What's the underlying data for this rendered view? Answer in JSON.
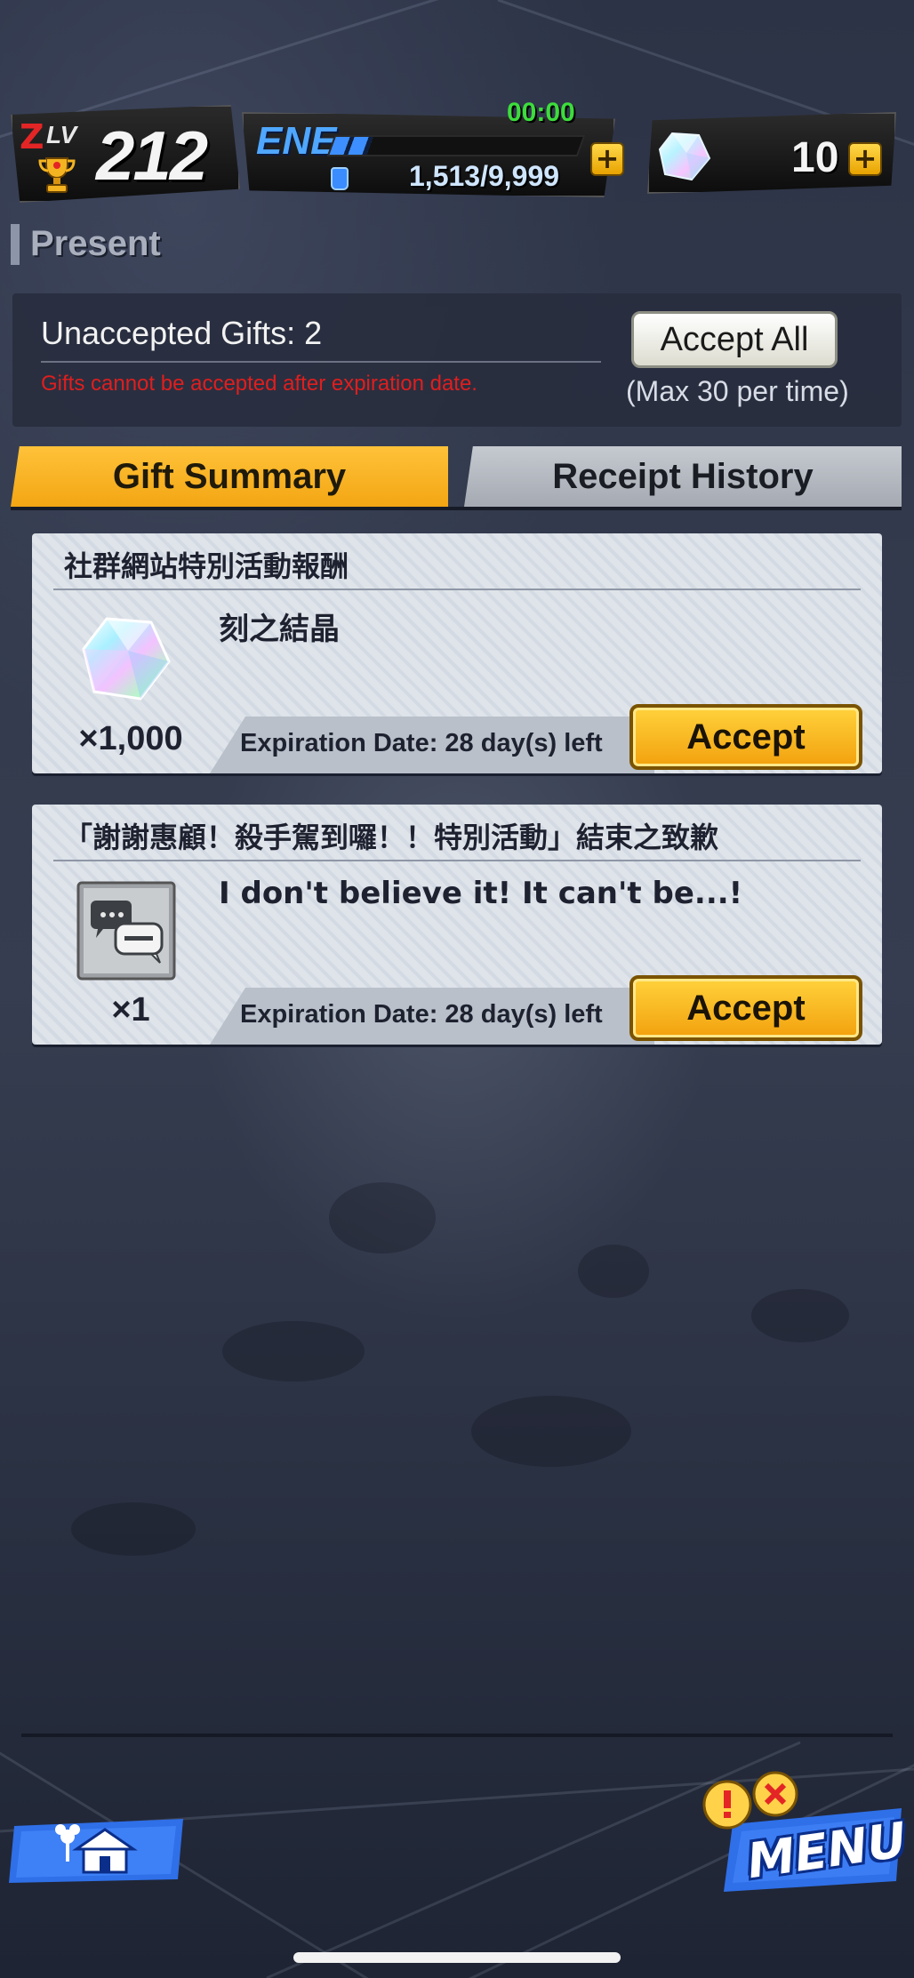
{
  "header": {
    "level_prefix_z": "Z",
    "level_prefix_lv": "LV",
    "level_value": "212",
    "energy_label": "ENE",
    "energy_timer": "00:00",
    "energy_value": "1,513/9,999",
    "energy_fill_fraction": 0.151,
    "energy_add_icon": "plus-icon",
    "gem_count": "10",
    "gem_add_icon": "plus-icon"
  },
  "page": {
    "title": "Present"
  },
  "info": {
    "unaccepted_text": "Unaccepted Gifts: 2",
    "warning_text": "Gifts cannot be accepted after expiration date.",
    "accept_all_label": "Accept All",
    "max_note": "(Max 30 per time)"
  },
  "tabs": [
    {
      "label": "Gift Summary",
      "active": true
    },
    {
      "label": "Receipt History",
      "active": false
    }
  ],
  "gifts": [
    {
      "title": "社群網站特別活動報酬",
      "item_name": "刻之結晶",
      "icon": "chrono-crystal-icon",
      "quantity": "×1,000",
      "expiry": "Expiration Date: 28 day(s) left",
      "accept_label": "Accept"
    },
    {
      "title": "「謝謝惠顧！殺手駕到囉！！特別活動」結束之致歉",
      "item_name": "I don't believe it! It can't be...!",
      "icon": "chat-stamp-icon",
      "quantity": "×1",
      "expiry": "Expiration Date: 28 day(s) left",
      "accept_label": "Accept"
    }
  ],
  "nav": {
    "home_icon": "home-icon",
    "menu_label": "MENU",
    "menu_alert_icon": "exclamation-badge-icon"
  },
  "colors": {
    "accent_gold": "#f3a613",
    "energy_blue": "#3d8fff",
    "timer_green": "#3ddc3d",
    "warning_red": "#e01e1e"
  }
}
